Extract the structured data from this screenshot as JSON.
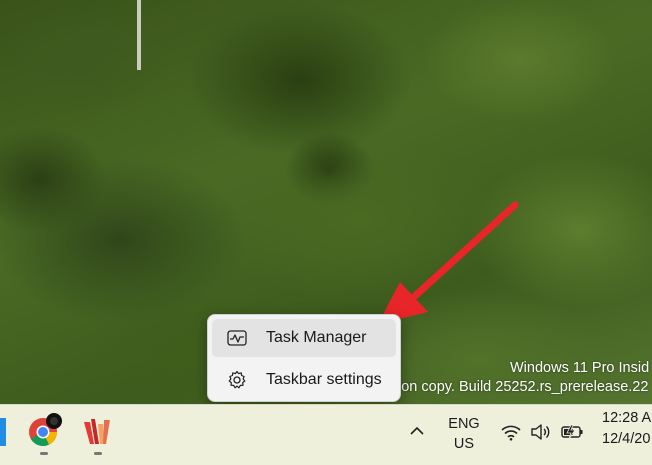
{
  "watermark": {
    "line1": "Windows 11 Pro Insid",
    "line2": "ion copy. Build 25252.rs_prerelease.22"
  },
  "context_menu": {
    "items": [
      {
        "label": "Task Manager",
        "icon": "task-manager-icon"
      },
      {
        "label": "Taskbar settings",
        "icon": "gear-icon"
      }
    ]
  },
  "taskbar": {
    "apps": [
      {
        "name": "Google Chrome",
        "icon": "chrome-icon"
      },
      {
        "name": "Paint app",
        "icon": "stripes-app-icon"
      }
    ],
    "tray": {
      "language_top": "ENG",
      "language_bottom": "US",
      "time": "12:28 A",
      "date": "12/4/20"
    }
  },
  "colors": {
    "annotation_arrow": "#e8262a",
    "menu_bg": "#f3f3f3",
    "taskbar_bg": "#eef0dc"
  }
}
